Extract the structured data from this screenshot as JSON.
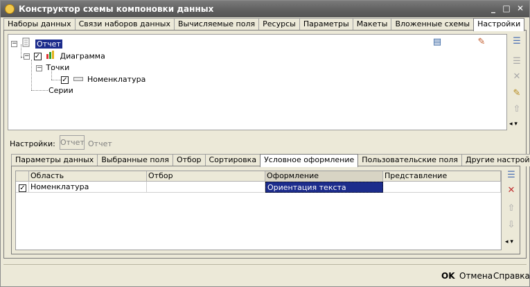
{
  "window": {
    "title": "Конструктор схемы компоновки данных",
    "controls": {
      "minimize": "_",
      "maximize": "□",
      "close": "✕"
    }
  },
  "top_tabs": [
    {
      "label": "Наборы данных"
    },
    {
      "label": "Связи наборов данных"
    },
    {
      "label": "Вычисляемые поля"
    },
    {
      "label": "Ресурсы"
    },
    {
      "label": "Параметры"
    },
    {
      "label": "Макеты"
    },
    {
      "label": "Вложенные схемы"
    },
    {
      "label": "Настройки",
      "active": true
    }
  ],
  "tree": {
    "report": "Отчет",
    "chart": "Диаграмма",
    "points": "Точки",
    "nomenclature": "Номенклатура",
    "series": "Серии"
  },
  "settings": {
    "label": "Настройки:",
    "button": "Отчет",
    "value": "Отчет"
  },
  "lower_tabs": [
    {
      "label": "Параметры данных"
    },
    {
      "label": "Выбранные поля"
    },
    {
      "label": "Отбор"
    },
    {
      "label": "Сортировка"
    },
    {
      "label": "Условное оформление",
      "active": true
    },
    {
      "label": "Пользовательские поля"
    },
    {
      "label": "Другие настройки"
    }
  ],
  "grid": {
    "columns": [
      "Область",
      "Отбор",
      "Оформление",
      "Представление"
    ],
    "rows": [
      {
        "checked": true,
        "area": "Номенклатура",
        "filter": "",
        "format": "Ориентация текста",
        "presentation": ""
      }
    ]
  },
  "footer": {
    "ok": "OK",
    "cancel": "Отмена",
    "help": "Справка"
  },
  "nav": {
    "more": "◂ ▾"
  }
}
